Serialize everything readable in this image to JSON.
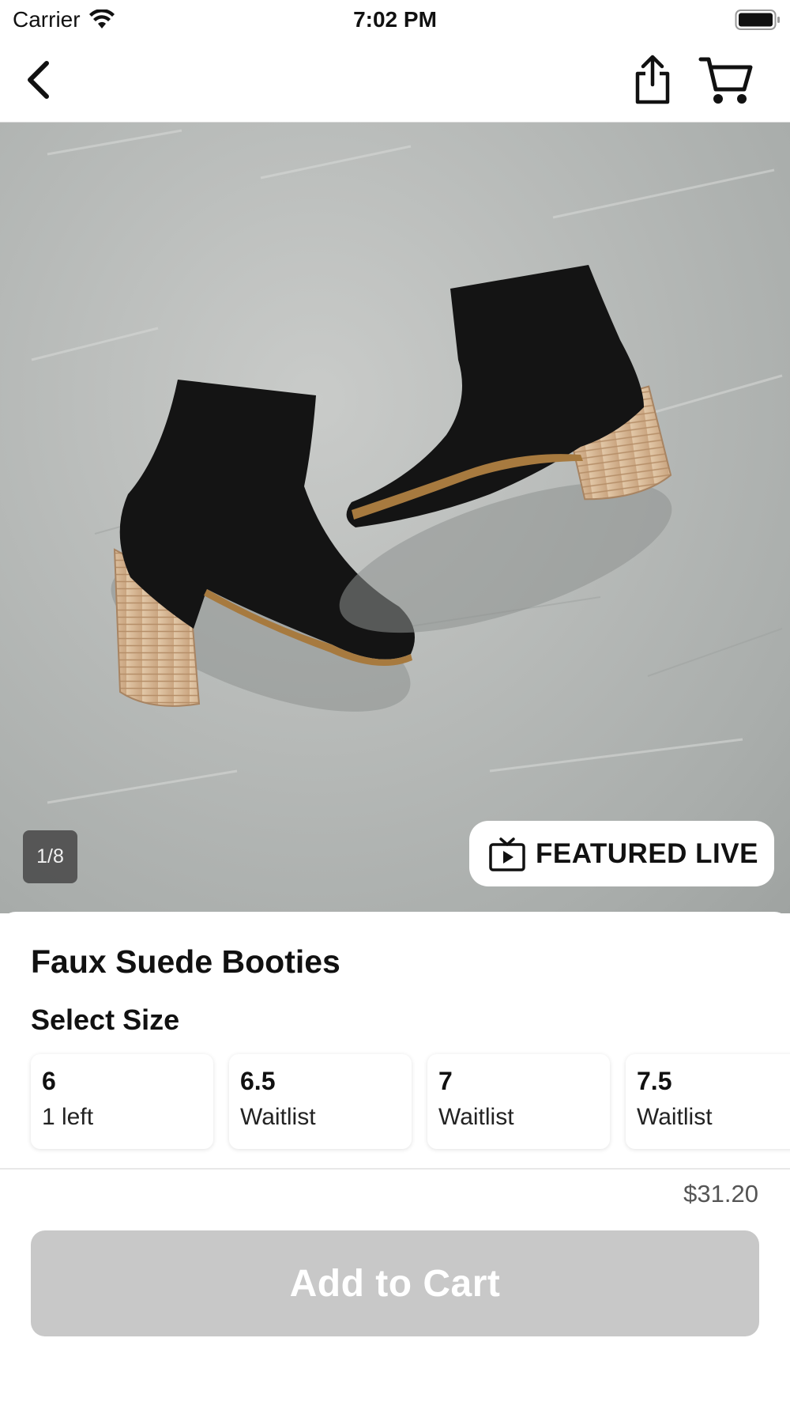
{
  "status_bar": {
    "carrier": "Carrier",
    "time": "7:02 PM"
  },
  "nav": {
    "back_icon": "chevron-left-icon",
    "share_icon": "share-icon",
    "cart_icon": "cart-icon"
  },
  "product": {
    "image_counter": "1/8",
    "featured_live_label": "FEATURED LIVE",
    "featured_icon": "tv-play-icon",
    "title": "Faux Suede Booties",
    "select_size_label": "Select Size",
    "sizes": [
      {
        "size": "6",
        "status": "1 left"
      },
      {
        "size": "6.5",
        "status": "Waitlist"
      },
      {
        "size": "7",
        "status": "Waitlist"
      },
      {
        "size": "7.5",
        "status": "Waitlist"
      }
    ],
    "price": "$31.20"
  },
  "footer": {
    "add_to_cart_label": "Add to Cart"
  },
  "colors": {
    "button_disabled": "#c8c8c8",
    "text_primary": "#111111",
    "price_text": "#555555"
  }
}
